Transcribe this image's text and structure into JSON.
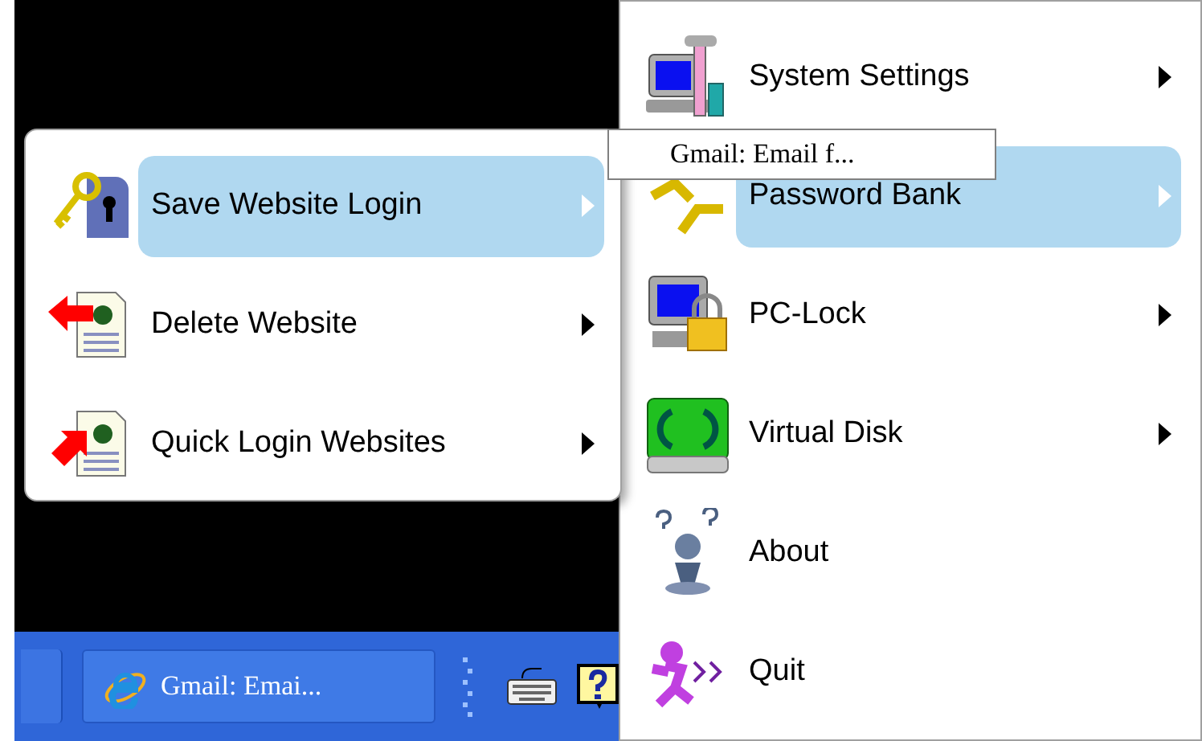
{
  "main_menu": {
    "items": [
      {
        "label": "System Settings",
        "selected": false,
        "has_submenu": true
      },
      {
        "label": "Password Bank",
        "selected": true,
        "has_submenu": true
      },
      {
        "label": "PC-Lock",
        "selected": false,
        "has_submenu": true
      },
      {
        "label": "Virtual Disk",
        "selected": false,
        "has_submenu": true
      },
      {
        "label": "About",
        "selected": false,
        "has_submenu": false
      },
      {
        "label": "Quit",
        "selected": false,
        "has_submenu": false
      }
    ]
  },
  "submenu": {
    "items": [
      {
        "label": "Save Website Login",
        "selected": true,
        "has_submenu": true
      },
      {
        "label": "Delete Website",
        "selected": false,
        "has_submenu": true
      },
      {
        "label": "Quick Login Websites",
        "selected": false,
        "has_submenu": true
      }
    ]
  },
  "tooltip": {
    "text": "Gmail: Email f..."
  },
  "taskbar": {
    "window_button": {
      "label": "Gmail: Emai..."
    }
  }
}
